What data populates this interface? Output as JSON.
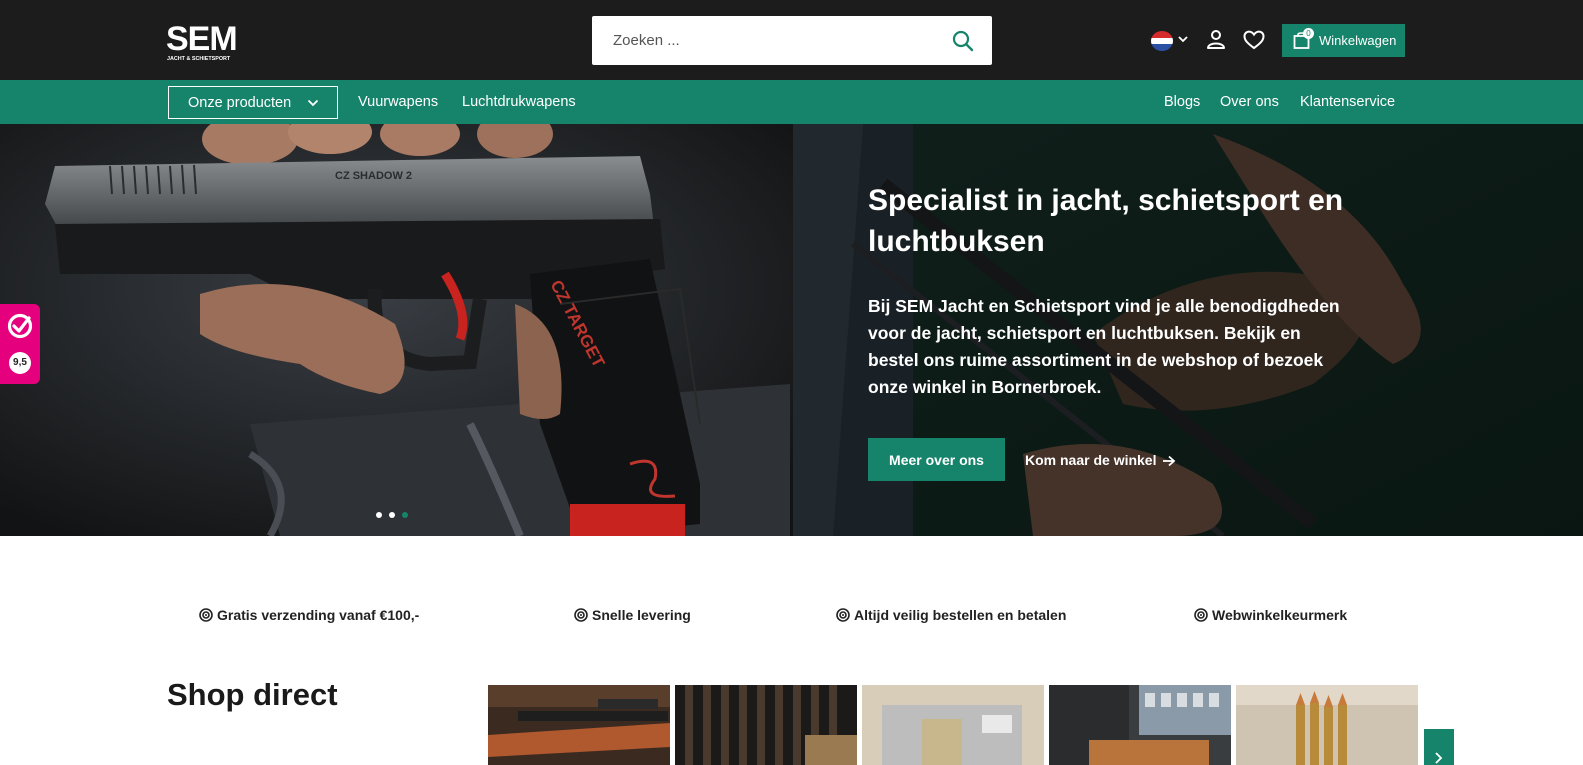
{
  "header": {
    "logo_text": "SEM",
    "logo_subtext": "JACHT & SCHIETSPORT",
    "search_placeholder": "Zoeken ...",
    "language_icon": "flag-nl-icon",
    "cart_label": "Winkelwagen",
    "cart_count": "0"
  },
  "nav": {
    "dropdown_label": "Onze producten",
    "left_links": [
      "Vuurwapens",
      "Luchtdrukwapens"
    ],
    "right_links": [
      "Blogs",
      "Over ons",
      "Klantenservice"
    ]
  },
  "hero": {
    "title": "Specialist in jacht, schietsport en luchtbuksen",
    "text": "Bij SEM Jacht en Schietsport vind je alle benodigdheden voor de jacht, schietsport en luchtbuksen. Bekijk en bestel ons ruime assortiment in de webshop of bezoek onze winkel in Bornerbroek.",
    "primary_button": "Meer over ons",
    "secondary_link": "Kom naar de winkel",
    "slides_total": 3,
    "active_slide": 3,
    "pistol_engraving": "CZ TARGET",
    "slide_engraving": "CZ SHADOW 2"
  },
  "review": {
    "score": "9,5"
  },
  "usps": [
    "Gratis verzending vanaf €100,-",
    "Snelle levering",
    "Altijd veilig bestellen en betalen",
    "Webwinkelkeurmerk"
  ],
  "shop": {
    "title": "Shop direct",
    "tile_count": 5
  },
  "colors": {
    "brand_green": "#16846b",
    "topbar": "#1c1c1c",
    "review_pink": "#e5007e"
  }
}
